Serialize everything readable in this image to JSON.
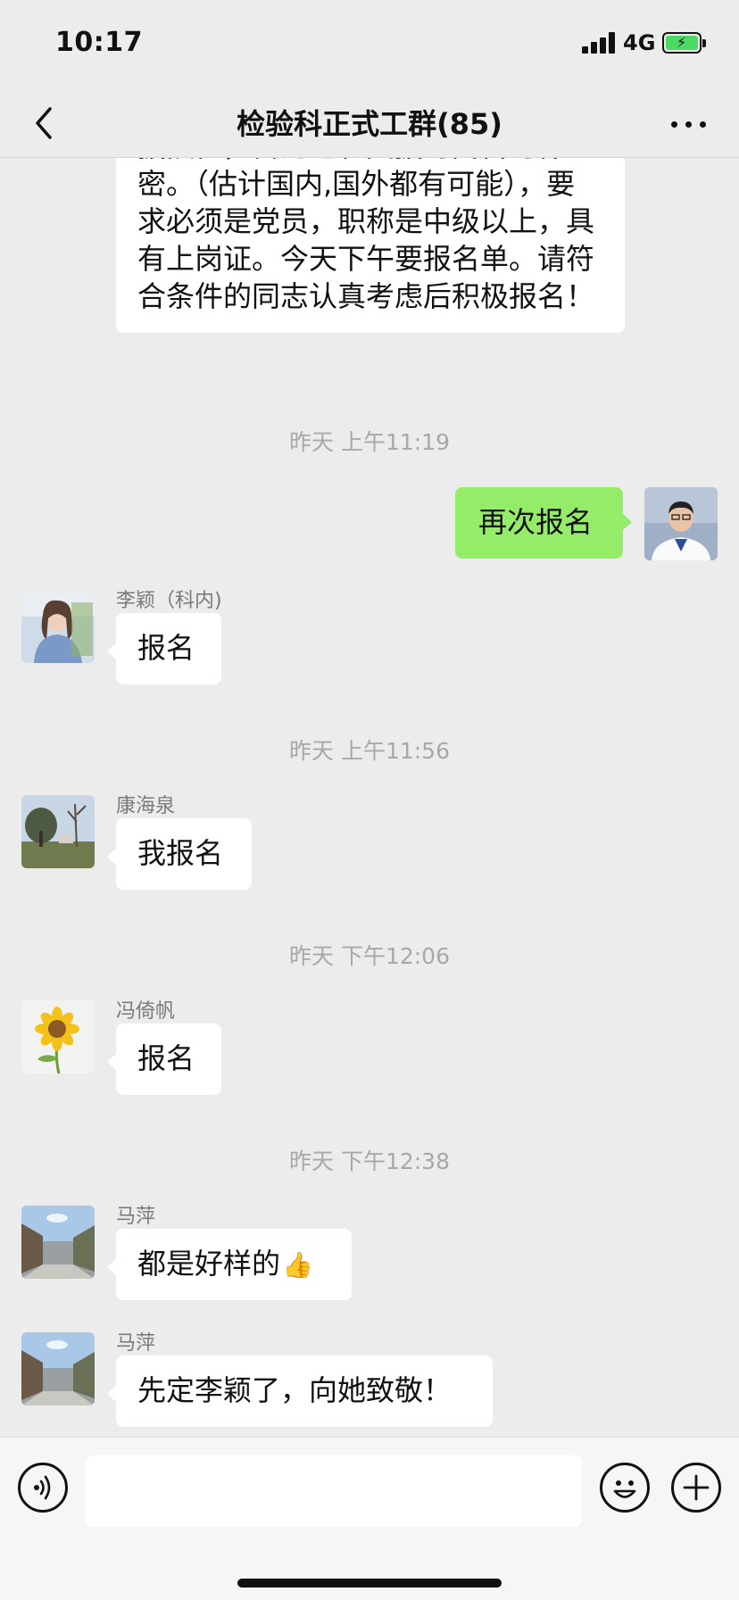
{
  "status_bar": {
    "time": "10:17",
    "network": "4G"
  },
  "header": {
    "title": "检验科正式工群(85)"
  },
  "messages": {
    "m0": {
      "text": "援队伍，目的地和支援时间暂时保密。（估计国内,国外都有可能），要求必须是党员，职称是中级以上，具有上岗证。今天下午要报名单。请符合条件的同志认真考虑后积极报名！"
    },
    "t1": "昨天 上午11:19",
    "m1": {
      "text": "再次报名"
    },
    "m2": {
      "sender": "李颖（科内)",
      "text": "报名"
    },
    "t2": "昨天 上午11:56",
    "m3": {
      "sender": "康海泉",
      "text": "我报名"
    },
    "t3": "昨天 下午12:06",
    "m4": {
      "sender": "冯倚帆",
      "text": "报名"
    },
    "t4": "昨天 下午12:38",
    "m5": {
      "sender": "马萍",
      "text": "都是好样的",
      "emoji": "👍"
    },
    "m6": {
      "sender": "马萍",
      "text": "先定李颖了，向她致敬！"
    }
  },
  "input_bar": {
    "placeholder": ""
  },
  "colors": {
    "background": "#ececec",
    "self_bubble": "#95ec69",
    "other_bubble": "#ffffff",
    "timestamp": "#a8a8a8"
  }
}
